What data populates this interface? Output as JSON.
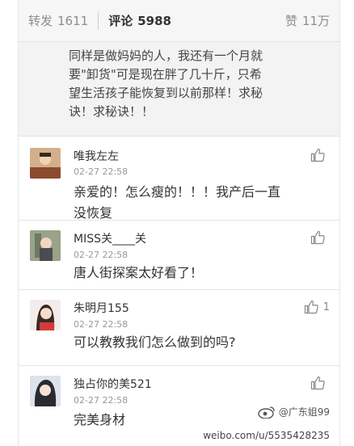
{
  "tabs": {
    "repost_label": "转发",
    "repost_count": "1611",
    "comments_label": "评论",
    "comments_count": "5988",
    "likes_label": "赞",
    "likes_count": "11万"
  },
  "top_comment": {
    "lines": [
      "同样是做妈妈的人，我还有一个月就",
      "要\"卸货\"可是现在胖了几十斤，只希",
      "望生活孩子能恢复到以前那样！求秘",
      "诀！求秘诀！！"
    ]
  },
  "comments": [
    {
      "name": "唯我左左",
      "time": "02-27 22:58",
      "text_lines": [
        "亲爱的！怎么瘦的！！！我产后一直",
        "没恢复"
      ],
      "likes": ""
    },
    {
      "name": "MISS关____关",
      "time": "02-27 22:58",
      "text_lines": [
        "唐人街探案太好看了！"
      ],
      "likes": ""
    },
    {
      "name": "朱明月155",
      "time": "02-27 22:58",
      "text_lines": [
        "可以教教我们怎么做到的吗?"
      ],
      "likes": "1"
    },
    {
      "name": "独占你的美521",
      "time": "02-27 22:58",
      "text_lines": [
        "完美身材"
      ],
      "likes": ""
    }
  ],
  "watermark": {
    "handle": "@广东姐99",
    "url": "weibo.com/u/5535428235"
  },
  "colors": {
    "accent": "#333333",
    "muted": "#999999",
    "tab_bg": "#f6f6f6"
  }
}
